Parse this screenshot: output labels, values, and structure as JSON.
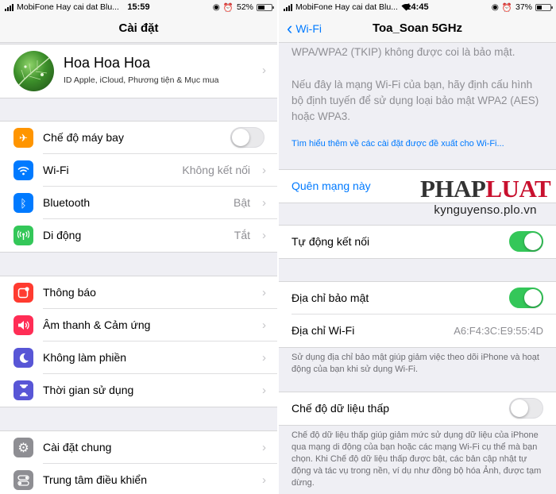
{
  "left": {
    "status": {
      "carrier": "MobiFone Hay cai dat Blu...",
      "time": "15:59",
      "battery": "52%",
      "battery_level": 0.52
    },
    "title": "Cài đặt",
    "profile": {
      "name": "Hoa Hoa Hoa",
      "subtitle": "ID Apple, iCloud, Phương tiện & Mục mua"
    },
    "group1": [
      {
        "label": "Chế độ máy bay",
        "icon": "airplane-icon",
        "color": "#ff9500",
        "toggle": false
      },
      {
        "label": "Wi-Fi",
        "icon": "wifi-icon",
        "color": "#007aff",
        "value": "Không kết nối"
      },
      {
        "label": "Bluetooth",
        "icon": "bluetooth-icon",
        "color": "#007aff",
        "value": "Bật"
      },
      {
        "label": "Di động",
        "icon": "cellular-icon",
        "color": "#34c759",
        "value": "Tắt"
      }
    ],
    "group2": [
      {
        "label": "Thông báo",
        "icon": "notifications-icon",
        "color": "#ff3b30"
      },
      {
        "label": "Âm thanh & Cảm ứng",
        "icon": "sound-icon",
        "color": "#ff2d55"
      },
      {
        "label": "Không làm phiền",
        "icon": "moon-icon",
        "color": "#5856d6"
      },
      {
        "label": "Thời gian sử dụng",
        "icon": "hourglass-icon",
        "color": "#5856d6"
      }
    ],
    "group3": [
      {
        "label": "Cài đặt chung",
        "icon": "gear-icon",
        "color": "#8e8e93"
      },
      {
        "label": "Trung tâm điều khiển",
        "icon": "control-center-icon",
        "color": "#8e8e93"
      }
    ]
  },
  "right": {
    "status": {
      "carrier": "MobiFone Hay cai dat Blu...",
      "time": "14:45",
      "battery": "37%",
      "battery_level": 0.37
    },
    "back": "Wi-Fi",
    "title": "Toa_Soan 5GHz",
    "warning_tail": "WPA/WPA2 (TKIP) không được coi là bảo mật.",
    "warning_p2": "Nếu đây là mạng Wi-Fi của bạn, hãy định cấu hình bộ định tuyến để sử dụng loại bảo mật WPA2 (AES) hoặc WPA3.",
    "learn_more": "Tìm hiểu thêm về các cài đặt được đề xuất cho Wi-Fi...",
    "forget": "Quên mạng này",
    "auto_join": {
      "label": "Tự động kết nối",
      "on": true
    },
    "private_address": {
      "label": "Địa chỉ bảo mật",
      "on": true
    },
    "wifi_address": {
      "label": "Địa chỉ Wi-Fi",
      "value": "A6:F4:3C:E9:55:4D"
    },
    "private_note": "Sử dụng địa chỉ bảo mật giúp giảm việc theo dõi iPhone và hoạt động của bạn khi sử dụng Wi-Fi.",
    "low_data": {
      "label": "Chế độ dữ liệu thấp",
      "on": false
    },
    "low_data_note": "Chế độ dữ liệu thấp giúp giảm mức sử dụng dữ liệu của iPhone qua mạng di động của bạn hoặc các mạng Wi-Fi cụ thể mà bạn chọn. Khi Chế độ dữ liệu thấp được bật, các bản cập nhật tự động và tác vụ trong nền, ví dụ như đồng bộ hóa Ảnh, được tạm dừng."
  },
  "watermark": {
    "brand_a": "PHAP",
    "brand_b": "LUAT",
    "site": "kynguyenso.plo.vn"
  },
  "colors": {
    "accent": "#007aff",
    "toggle_on": "#34c759",
    "background": "#efeff4"
  }
}
